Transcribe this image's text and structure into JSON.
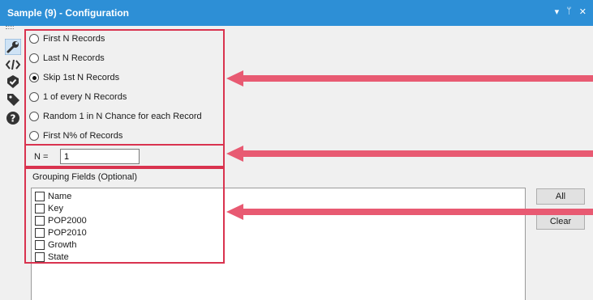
{
  "window": {
    "title": "Sample (9) - Configuration",
    "controls": [
      "▾",
      "ᛘ",
      "✕"
    ]
  },
  "toolbar": {
    "tools": [
      "wrench-icon",
      "code-icon",
      "check-shield-icon",
      "tag-icon",
      "help-icon"
    ]
  },
  "sampling": {
    "options": [
      {
        "label": "First N Records",
        "selected": false
      },
      {
        "label": "Last N Records",
        "selected": false
      },
      {
        "label": "Skip 1st N Records",
        "selected": true
      },
      {
        "label": "1 of every N Records",
        "selected": false
      },
      {
        "label": "Random 1 in N Chance for each Record",
        "selected": false
      },
      {
        "label": "First N% of Records",
        "selected": false
      }
    ]
  },
  "n_field": {
    "label": "N =",
    "value": "1"
  },
  "grouping": {
    "label": "Grouping Fields (Optional)",
    "fields": [
      {
        "name": "Name",
        "checked": false
      },
      {
        "name": "Key",
        "checked": false
      },
      {
        "name": "POP2000",
        "checked": false
      },
      {
        "name": "POP2010",
        "checked": false
      },
      {
        "name": "Growth",
        "checked": false
      },
      {
        "name": "State",
        "checked": false
      }
    ],
    "all_label": "All",
    "clear_label": "Clear"
  },
  "colors": {
    "title_bar": "#2d8fd6",
    "highlight": "#d9334f",
    "arrow": "#e85a72"
  }
}
